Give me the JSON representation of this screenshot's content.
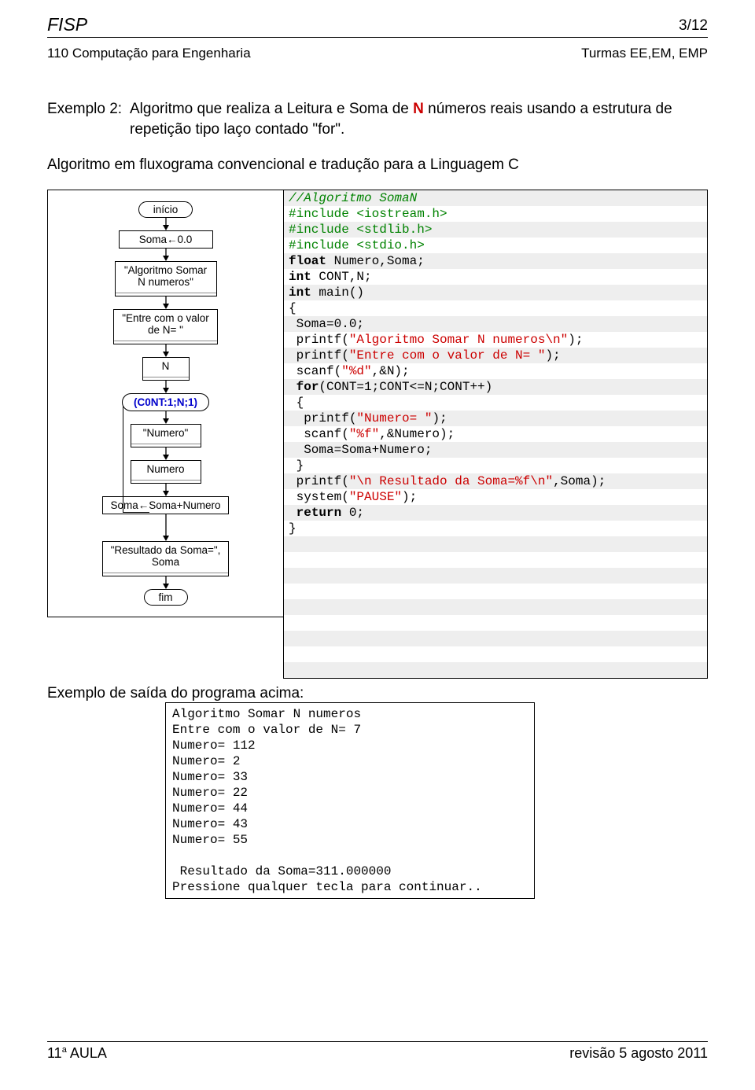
{
  "header": {
    "left": "FISP",
    "right": "3/12"
  },
  "subheader": {
    "left": "110 Computação para Engenharia",
    "right": "Turmas EE,EM, EMP"
  },
  "intro": {
    "label": "Exemplo 2:",
    "text_before_N": "Algoritmo que realiza a Leitura e Soma de ",
    "N": "N",
    "text_after_N": " números reais usando a estrutura de repetição tipo laço contado \"for\"."
  },
  "para2": "Algoritmo em fluxograma convencional e tradução para a Linguagem C",
  "flow": {
    "inicio": "início",
    "soma0": "Soma←0.0",
    "io1a": "\"Algoritmo Somar",
    "io1b": "N numeros\"",
    "io2a": "\"Entre com o valor",
    "io2b": "de N= \"",
    "ioN": "N",
    "loop": "(C0NT:1;N;1)",
    "ioNum": "\"Numero\"",
    "ioNumIn": "Numero",
    "assign": "Soma←Soma+Numero",
    "ioRes1": "\"Resultado da Soma=\",",
    "ioRes2": "Soma",
    "fim": "fim"
  },
  "code": [
    {
      "t": "cmt",
      "s": "//Algoritmo SomaN"
    },
    {
      "t": "pre",
      "s": "#include <iostream.h>"
    },
    {
      "t": "pre",
      "s": "#include <stdlib.h>"
    },
    {
      "t": "pre",
      "s": "#include <stdio.h>"
    },
    {
      "t": "mix",
      "parts": [
        {
          "c": "kw",
          "s": "float"
        },
        {
          "c": "",
          "s": " Numero,Soma;"
        }
      ]
    },
    {
      "t": "mix",
      "parts": [
        {
          "c": "kw",
          "s": "int"
        },
        {
          "c": "",
          "s": " CONT,N;"
        }
      ]
    },
    {
      "t": "mix",
      "parts": [
        {
          "c": "kw",
          "s": "int"
        },
        {
          "c": "",
          "s": " main()"
        }
      ]
    },
    {
      "t": "txt",
      "s": "{"
    },
    {
      "t": "txt",
      "s": " Soma=0.0;"
    },
    {
      "t": "mix",
      "parts": [
        {
          "c": "",
          "s": " printf("
        },
        {
          "c": "str",
          "s": "\"Algoritmo Somar N numeros\\n\""
        },
        {
          "c": "",
          "s": ");"
        }
      ]
    },
    {
      "t": "mix",
      "parts": [
        {
          "c": "",
          "s": " printf("
        },
        {
          "c": "str",
          "s": "\"Entre com o valor de N= \""
        },
        {
          "c": "",
          "s": ");"
        }
      ]
    },
    {
      "t": "mix",
      "parts": [
        {
          "c": "",
          "s": " scanf("
        },
        {
          "c": "str",
          "s": "\"%d\""
        },
        {
          "c": "",
          "s": ",&N);"
        }
      ]
    },
    {
      "t": "mix",
      "parts": [
        {
          "c": "",
          "s": " "
        },
        {
          "c": "kw",
          "s": "for"
        },
        {
          "c": "",
          "s": "(CONT=1;CONT<=N;CONT++)"
        }
      ]
    },
    {
      "t": "txt",
      "s": " {"
    },
    {
      "t": "mix",
      "parts": [
        {
          "c": "",
          "s": "  printf("
        },
        {
          "c": "str",
          "s": "\"Numero= \""
        },
        {
          "c": "",
          "s": ");"
        }
      ]
    },
    {
      "t": "mix",
      "parts": [
        {
          "c": "",
          "s": "  scanf("
        },
        {
          "c": "str",
          "s": "\"%f\""
        },
        {
          "c": "",
          "s": ",&Numero);"
        }
      ]
    },
    {
      "t": "txt",
      "s": "  Soma=Soma+Numero;"
    },
    {
      "t": "txt",
      "s": " }"
    },
    {
      "t": "mix",
      "parts": [
        {
          "c": "",
          "s": " printf("
        },
        {
          "c": "str",
          "s": "\"\\n Resultado da Soma=%f\\n\""
        },
        {
          "c": "",
          "s": ",Soma);"
        }
      ]
    },
    {
      "t": "mix",
      "parts": [
        {
          "c": "",
          "s": " system("
        },
        {
          "c": "str",
          "s": "\"PAUSE\""
        },
        {
          "c": "",
          "s": ");"
        }
      ]
    },
    {
      "t": "mix",
      "parts": [
        {
          "c": "",
          "s": " "
        },
        {
          "c": "kw",
          "s": "return"
        },
        {
          "c": "",
          "s": " 0;"
        }
      ]
    },
    {
      "t": "txt",
      "s": "}"
    },
    {
      "t": "txt",
      "s": " "
    },
    {
      "t": "txt",
      "s": " "
    },
    {
      "t": "txt",
      "s": " "
    },
    {
      "t": "txt",
      "s": " "
    },
    {
      "t": "txt",
      "s": " "
    },
    {
      "t": "txt",
      "s": " "
    },
    {
      "t": "txt",
      "s": " "
    },
    {
      "t": "txt",
      "s": " "
    },
    {
      "t": "txt",
      "s": " "
    }
  ],
  "outcap": "Exemplo de saída do programa acima:",
  "output": [
    "Algoritmo Somar N numeros",
    "Entre com o valor de N= 7",
    "Numero= 112",
    "Numero= 2",
    "Numero= 33",
    "Numero= 22",
    "Numero= 44",
    "Numero= 43",
    "Numero= 55",
    "",
    " Resultado da Soma=311.000000",
    "Pressione qualquer tecla para continuar.."
  ],
  "footer": {
    "left_a": "11",
    "left_sup": "a",
    "left_b": " AULA",
    "right": "revisão 5 agosto 2011"
  }
}
